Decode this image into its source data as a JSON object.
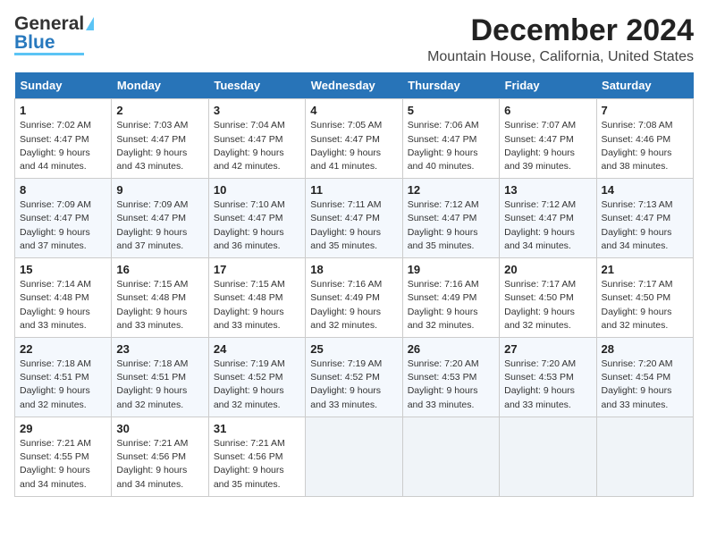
{
  "header": {
    "logo_line1": "General",
    "logo_line2": "Blue",
    "month": "December 2024",
    "location": "Mountain House, California, United States"
  },
  "days_of_week": [
    "Sunday",
    "Monday",
    "Tuesday",
    "Wednesday",
    "Thursday",
    "Friday",
    "Saturday"
  ],
  "weeks": [
    [
      {
        "day": "1",
        "sunrise": "Sunrise: 7:02 AM",
        "sunset": "Sunset: 4:47 PM",
        "daylight": "Daylight: 9 hours and 44 minutes."
      },
      {
        "day": "2",
        "sunrise": "Sunrise: 7:03 AM",
        "sunset": "Sunset: 4:47 PM",
        "daylight": "Daylight: 9 hours and 43 minutes."
      },
      {
        "day": "3",
        "sunrise": "Sunrise: 7:04 AM",
        "sunset": "Sunset: 4:47 PM",
        "daylight": "Daylight: 9 hours and 42 minutes."
      },
      {
        "day": "4",
        "sunrise": "Sunrise: 7:05 AM",
        "sunset": "Sunset: 4:47 PM",
        "daylight": "Daylight: 9 hours and 41 minutes."
      },
      {
        "day": "5",
        "sunrise": "Sunrise: 7:06 AM",
        "sunset": "Sunset: 4:47 PM",
        "daylight": "Daylight: 9 hours and 40 minutes."
      },
      {
        "day": "6",
        "sunrise": "Sunrise: 7:07 AM",
        "sunset": "Sunset: 4:47 PM",
        "daylight": "Daylight: 9 hours and 39 minutes."
      },
      {
        "day": "7",
        "sunrise": "Sunrise: 7:08 AM",
        "sunset": "Sunset: 4:46 PM",
        "daylight": "Daylight: 9 hours and 38 minutes."
      }
    ],
    [
      {
        "day": "8",
        "sunrise": "Sunrise: 7:09 AM",
        "sunset": "Sunset: 4:47 PM",
        "daylight": "Daylight: 9 hours and 37 minutes."
      },
      {
        "day": "9",
        "sunrise": "Sunrise: 7:09 AM",
        "sunset": "Sunset: 4:47 PM",
        "daylight": "Daylight: 9 hours and 37 minutes."
      },
      {
        "day": "10",
        "sunrise": "Sunrise: 7:10 AM",
        "sunset": "Sunset: 4:47 PM",
        "daylight": "Daylight: 9 hours and 36 minutes."
      },
      {
        "day": "11",
        "sunrise": "Sunrise: 7:11 AM",
        "sunset": "Sunset: 4:47 PM",
        "daylight": "Daylight: 9 hours and 35 minutes."
      },
      {
        "day": "12",
        "sunrise": "Sunrise: 7:12 AM",
        "sunset": "Sunset: 4:47 PM",
        "daylight": "Daylight: 9 hours and 35 minutes."
      },
      {
        "day": "13",
        "sunrise": "Sunrise: 7:12 AM",
        "sunset": "Sunset: 4:47 PM",
        "daylight": "Daylight: 9 hours and 34 minutes."
      },
      {
        "day": "14",
        "sunrise": "Sunrise: 7:13 AM",
        "sunset": "Sunset: 4:47 PM",
        "daylight": "Daylight: 9 hours and 34 minutes."
      }
    ],
    [
      {
        "day": "15",
        "sunrise": "Sunrise: 7:14 AM",
        "sunset": "Sunset: 4:48 PM",
        "daylight": "Daylight: 9 hours and 33 minutes."
      },
      {
        "day": "16",
        "sunrise": "Sunrise: 7:15 AM",
        "sunset": "Sunset: 4:48 PM",
        "daylight": "Daylight: 9 hours and 33 minutes."
      },
      {
        "day": "17",
        "sunrise": "Sunrise: 7:15 AM",
        "sunset": "Sunset: 4:48 PM",
        "daylight": "Daylight: 9 hours and 33 minutes."
      },
      {
        "day": "18",
        "sunrise": "Sunrise: 7:16 AM",
        "sunset": "Sunset: 4:49 PM",
        "daylight": "Daylight: 9 hours and 32 minutes."
      },
      {
        "day": "19",
        "sunrise": "Sunrise: 7:16 AM",
        "sunset": "Sunset: 4:49 PM",
        "daylight": "Daylight: 9 hours and 32 minutes."
      },
      {
        "day": "20",
        "sunrise": "Sunrise: 7:17 AM",
        "sunset": "Sunset: 4:50 PM",
        "daylight": "Daylight: 9 hours and 32 minutes."
      },
      {
        "day": "21",
        "sunrise": "Sunrise: 7:17 AM",
        "sunset": "Sunset: 4:50 PM",
        "daylight": "Daylight: 9 hours and 32 minutes."
      }
    ],
    [
      {
        "day": "22",
        "sunrise": "Sunrise: 7:18 AM",
        "sunset": "Sunset: 4:51 PM",
        "daylight": "Daylight: 9 hours and 32 minutes."
      },
      {
        "day": "23",
        "sunrise": "Sunrise: 7:18 AM",
        "sunset": "Sunset: 4:51 PM",
        "daylight": "Daylight: 9 hours and 32 minutes."
      },
      {
        "day": "24",
        "sunrise": "Sunrise: 7:19 AM",
        "sunset": "Sunset: 4:52 PM",
        "daylight": "Daylight: 9 hours and 32 minutes."
      },
      {
        "day": "25",
        "sunrise": "Sunrise: 7:19 AM",
        "sunset": "Sunset: 4:52 PM",
        "daylight": "Daylight: 9 hours and 33 minutes."
      },
      {
        "day": "26",
        "sunrise": "Sunrise: 7:20 AM",
        "sunset": "Sunset: 4:53 PM",
        "daylight": "Daylight: 9 hours and 33 minutes."
      },
      {
        "day": "27",
        "sunrise": "Sunrise: 7:20 AM",
        "sunset": "Sunset: 4:53 PM",
        "daylight": "Daylight: 9 hours and 33 minutes."
      },
      {
        "day": "28",
        "sunrise": "Sunrise: 7:20 AM",
        "sunset": "Sunset: 4:54 PM",
        "daylight": "Daylight: 9 hours and 33 minutes."
      }
    ],
    [
      {
        "day": "29",
        "sunrise": "Sunrise: 7:21 AM",
        "sunset": "Sunset: 4:55 PM",
        "daylight": "Daylight: 9 hours and 34 minutes."
      },
      {
        "day": "30",
        "sunrise": "Sunrise: 7:21 AM",
        "sunset": "Sunset: 4:56 PM",
        "daylight": "Daylight: 9 hours and 34 minutes."
      },
      {
        "day": "31",
        "sunrise": "Sunrise: 7:21 AM",
        "sunset": "Sunset: 4:56 PM",
        "daylight": "Daylight: 9 hours and 35 minutes."
      },
      null,
      null,
      null,
      null
    ]
  ]
}
